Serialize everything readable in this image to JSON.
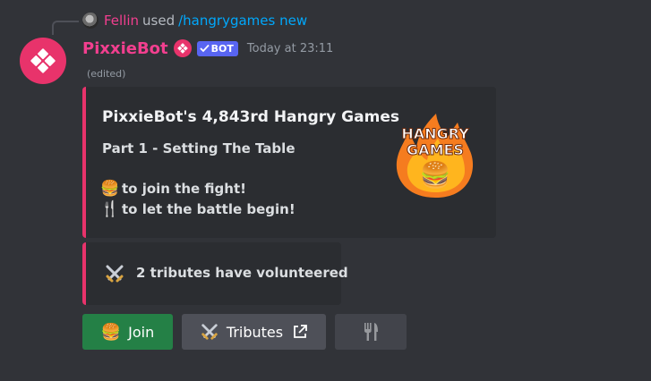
{
  "reply": {
    "user": "Fellin",
    "used": "used",
    "command": "/hangrygames new"
  },
  "message": {
    "author": "PixxieBot",
    "bot_tag": "BOT",
    "timestamp": "Today at 23:11",
    "edited": "(edited)"
  },
  "embed": {
    "title": "PixxieBot's 4,843rd Hangry Games",
    "subtitle": "Part 1 - Setting The Table",
    "join_line_emoji": "🍔",
    "join_line_text": "to join the fight!",
    "start_line_emoji": "🍴",
    "start_line_text": "to let the battle begin!",
    "thumbnail_text_1": "HANGRY",
    "thumbnail_text_2": "GAMES",
    "thumbnail_emoji": "🍔"
  },
  "status_embed": {
    "icon": "crossed-swords-icon",
    "text": "2 tributes have volunteered"
  },
  "buttons": {
    "join_emoji": "🍔",
    "join_label": "Join",
    "tributes_label": "Tributes",
    "fork_icon": "fork-knife-icon"
  },
  "colors": {
    "background": "#313338",
    "embed_bg": "#2b2d31",
    "accent": "#e8336b",
    "author": "#f23f8f",
    "command": "#00a8fc",
    "join_button": "#248046",
    "secondary_button": "#4e5058",
    "bot_tag": "#5865f2"
  }
}
